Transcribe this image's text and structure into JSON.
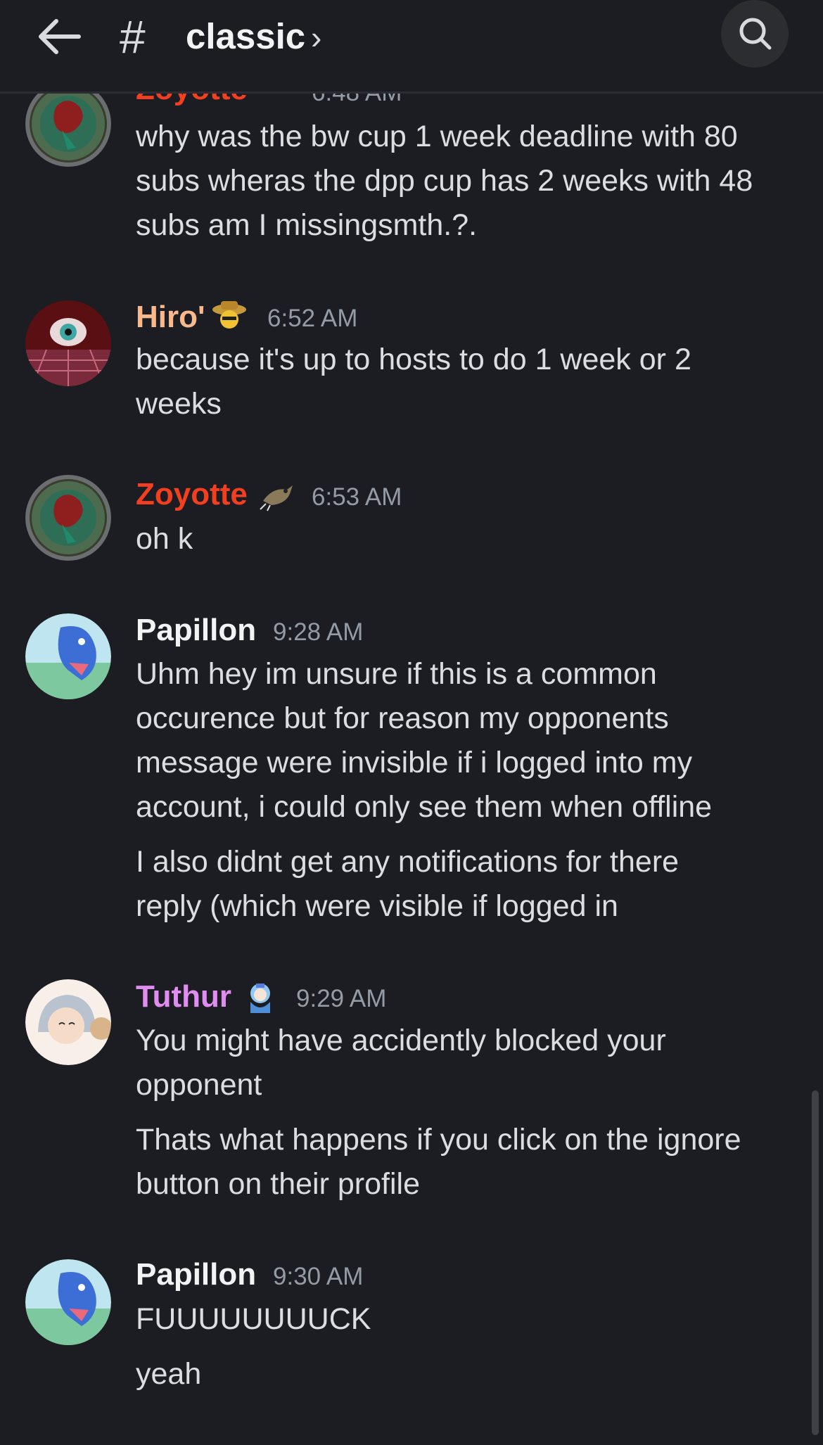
{
  "header": {
    "hash_symbol": "#",
    "channel_name": "classic",
    "chevron": "›",
    "back_icon": "arrow-left-icon",
    "search_icon": "search-icon"
  },
  "messages": [
    {
      "author": "Zoyotte",
      "author_color": "#f23f1f",
      "timestamp": "6:48 AM",
      "lines": [
        "why was the bw cup 1 week deadline with 80",
        "subs wheras the dpp cup has 2 weeks with 48",
        "subs am I missingsmth.?."
      ]
    },
    {
      "author": "Hiro'",
      "author_color": "#f9b98c",
      "timestamp": "6:52 AM",
      "lines": [
        "because it's up to hosts to do 1 week or 2",
        "weeks"
      ]
    },
    {
      "author": "Zoyotte",
      "author_color": "#f23f1f",
      "timestamp": "6:53 AM",
      "lines": [
        "oh k"
      ]
    },
    {
      "author": "Papillon",
      "author_color": "#f2f3f5",
      "timestamp": "9:28 AM",
      "lines": [
        "Uhm hey im unsure if this is a common",
        "occurence but for reason my opponents",
        "message were invisible if i logged into my",
        "account, i could only see them when offline"
      ],
      "followups": [
        [
          "I also didnt get any notifications for there",
          "reply (which were visible if logged in"
        ]
      ]
    },
    {
      "author": "Tuthur",
      "author_color": "#e08cf0",
      "timestamp": "9:29 AM",
      "lines": [
        "You might have accidently blocked your",
        "opponent"
      ],
      "followups": [
        [
          "Thats what happens if you click on the ignore",
          "button on their profile"
        ]
      ]
    },
    {
      "author": "Papillon",
      "author_color": "#f2f3f5",
      "timestamp": "9:30 AM",
      "lines": [
        "FUUUUUUUUCK"
      ],
      "followups": [
        [
          "yeah"
        ]
      ]
    }
  ]
}
